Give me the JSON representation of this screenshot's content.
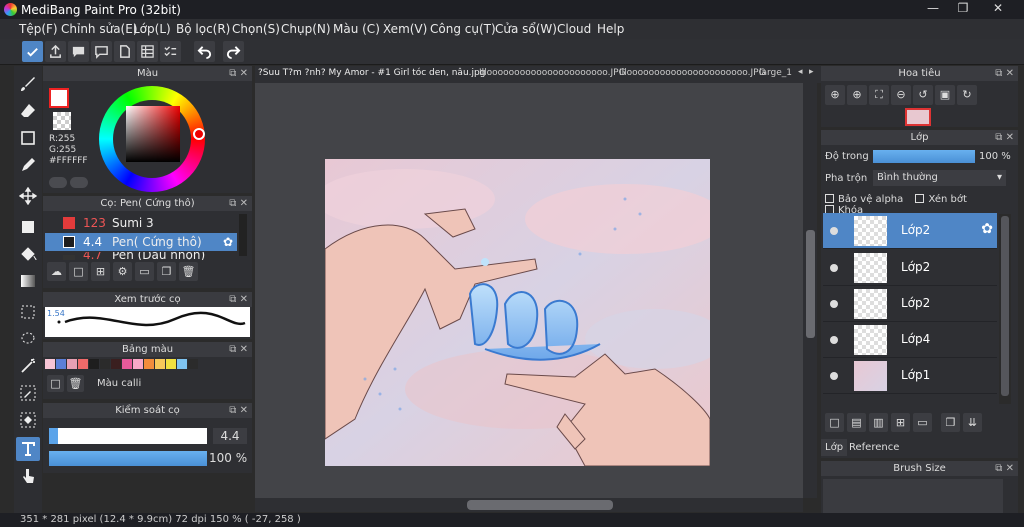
{
  "window": {
    "title": "MediBang Paint Pro (32bit)",
    "minimize": "—",
    "maximize": "❐",
    "close": "✕"
  },
  "menu": [
    {
      "label": "Tệp(F)"
    },
    {
      "label": "Chỉnh sửa(E)"
    },
    {
      "label": "Lớp(L)"
    },
    {
      "label": "Bộ lọc(R)"
    },
    {
      "label": "Chọn(S)"
    },
    {
      "label": "Chụp(N)"
    },
    {
      "label": "Màu (C)"
    },
    {
      "label": "Xem(V)"
    },
    {
      "label": "Công cụ(T)"
    },
    {
      "label": "Cửa sổ(W)"
    },
    {
      "label": "Cloud"
    },
    {
      "label": "Help"
    }
  ],
  "color_panel": {
    "title": "Màu",
    "r": "R:255",
    "g": "G:255",
    "hex": "#FFFFFF"
  },
  "brush_panel": {
    "title": "Cọ: Pen( Cứng thô)",
    "brushes": [
      {
        "size": "123",
        "name": "Sumi 3",
        "color": "#e33b3b"
      },
      {
        "size": "4.4",
        "name": "Pen( Cứng thô)",
        "color": "#ffffff"
      },
      {
        "size": "4.7",
        "name": "Pen (Dầu nhọn)",
        "color": "#333333"
      }
    ]
  },
  "preview_panel": {
    "title": "Xem trước cọ",
    "value": "1.54"
  },
  "palette_panel": {
    "title": "Bảng màu",
    "name": "Màu calli",
    "colors": [
      "#f7c4d4",
      "#5c7fd6",
      "#e8a0b4",
      "#f06a6a",
      "#1e1e1e",
      "#2b2b2b",
      "#3a1f1f",
      "#e85a9a",
      "#f7a8c8",
      "#f28c3c",
      "#f7c85a",
      "#f0e040",
      "#7fc4f0",
      "#2b2b2b"
    ]
  },
  "control_panel": {
    "title": "Kiểm soát cọ",
    "size": "4.4",
    "size_fraction": 0.06,
    "opacity": "100 %"
  },
  "tabs": [
    {
      "label": "?Suu T?m ?nh? My Amor - #1 Girl tóc den, nâu.jpg"
    },
    {
      "label": "Illoooooooooooooooooooooo.JPG"
    },
    {
      "label": "Illoooooooooooooooooooooo.JPG"
    },
    {
      "label": "large_1"
    }
  ],
  "status": {
    "text": "351 * 281 pixel   (12.4 * 9.9cm)   72 dpi   150 %   ( -27, 258 )"
  },
  "navigator": {
    "title": "Hoa tiêu"
  },
  "layer_panel": {
    "title": "Lớp",
    "opacity_label": "Độ trong",
    "opacity_value": "100 %",
    "blend_label": "Pha trộn",
    "blend_value": "Bình thường",
    "protect_alpha": "Bảo vệ alpha",
    "clipping": "Xén bớt",
    "lock": "Khóa",
    "layers": [
      {
        "name": "Lớp2",
        "selected": true
      },
      {
        "name": "Lớp2",
        "selected": false
      },
      {
        "name": "Lớp2",
        "selected": false
      },
      {
        "name": "Lớp4",
        "selected": false
      },
      {
        "name": "Lớp1",
        "selected": false
      }
    ],
    "tab_layer": "Lớp",
    "tab_reference": "Reference"
  },
  "brushsize_panel": {
    "title": "Brush Size"
  },
  "colors": {
    "accent": "#4f86c6",
    "panel": "#2e2f33",
    "canvas_bg": "#434448"
  }
}
